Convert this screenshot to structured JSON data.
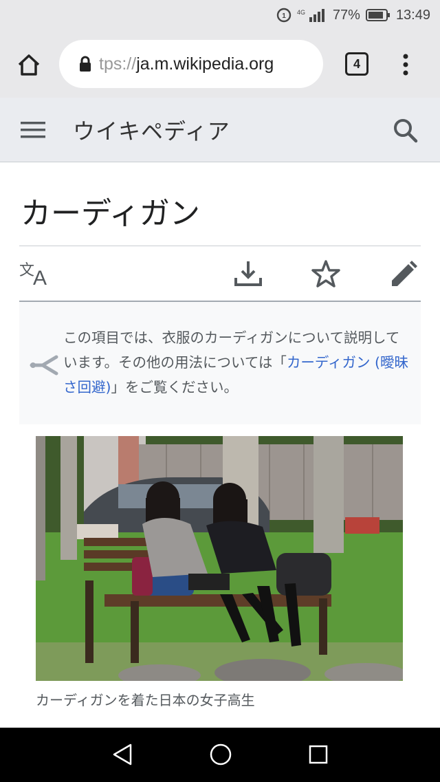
{
  "status": {
    "network": "4G",
    "battery_percent": "77%",
    "time": "13:49",
    "icons": [
      "sync-icon",
      "signal-icon",
      "battery-icon"
    ]
  },
  "browser": {
    "url_faded": "tps://",
    "url_host": "ja.m.wikipedia.org",
    "tab_count": "4",
    "icons": [
      "home-icon",
      "lock-icon",
      "tabs-icon",
      "overflow-menu-icon"
    ]
  },
  "wiki": {
    "logo_text": "ウイキペディア",
    "icons": [
      "hamburger-icon",
      "search-icon"
    ]
  },
  "article": {
    "title": "カーディガン",
    "actions": [
      "language-icon",
      "download-icon",
      "star-icon",
      "edit-icon"
    ],
    "hatnote": {
      "text_before": "この項目では、衣服のカーディガンについて説明しています。その他の用法については「",
      "link": "カーディガン (曖昧さ回避)",
      "text_after": "」をご覧ください。"
    },
    "image_caption": "カーディガンを着た日本の女子高生"
  },
  "colors": {
    "link": "#3366cc",
    "header_bg": "#eaecf0",
    "browser_bg": "#e8e8ea"
  }
}
